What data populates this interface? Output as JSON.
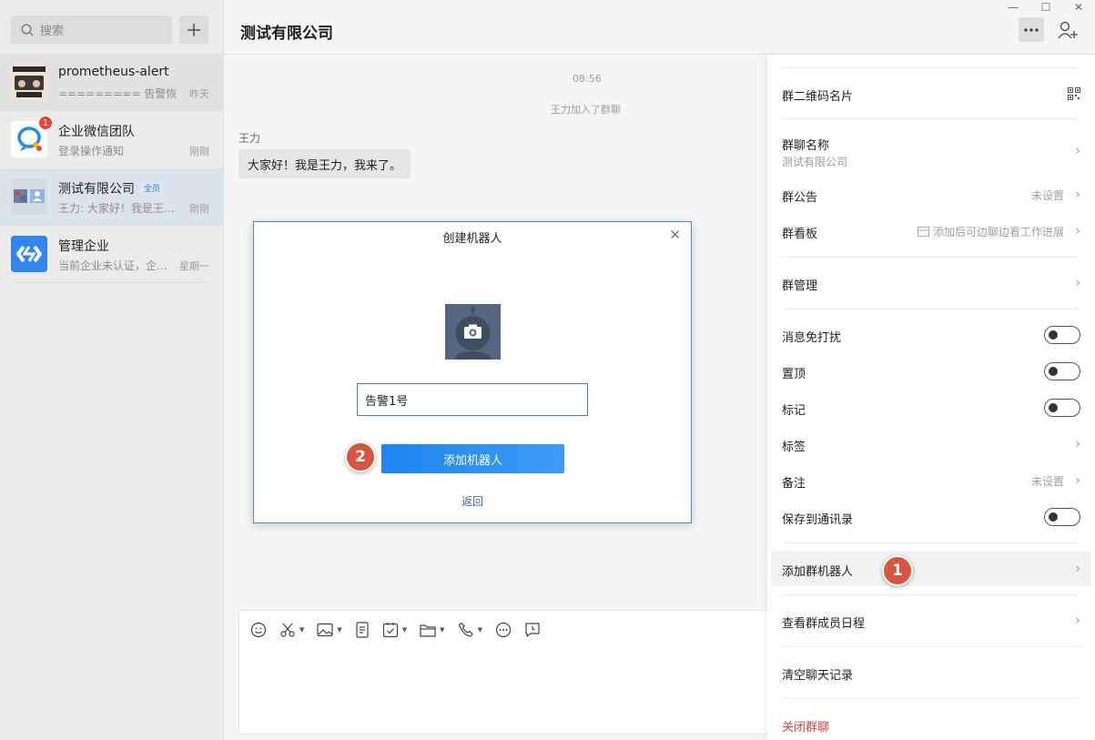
{
  "sidebar": {
    "search_placeholder": "搜索",
    "conversations": [
      {
        "name": "prometheus-alert",
        "preview": "========= 告警恢...",
        "time": "昨天",
        "badge": null
      },
      {
        "name": "企业微信团队",
        "preview": "登录操作通知",
        "time": "刚刚",
        "badge": "1"
      },
      {
        "name": "测试有限公司",
        "tag": "全员",
        "preview": "王力: 大家好！我是王...",
        "time": "刚刚"
      },
      {
        "name": "管理企业",
        "preview": "当前企业未认证，企...",
        "time": "星期一"
      }
    ]
  },
  "chat": {
    "title": "测试有限公司",
    "time_divider": "08:56",
    "system_message": "王力加入了群聊",
    "sender": "王力",
    "message": "大家好！我是王力，我来了。"
  },
  "dialog": {
    "title": "创建机器人",
    "name_value": "告警1号",
    "add_button": "添加机器人",
    "back_link": "返回"
  },
  "panel": {
    "qr_card": "群二维码名片",
    "group_name_label": "群聊名称",
    "group_name_value": "测试有限公司",
    "announcement": "群公告",
    "announcement_value": "未设置",
    "board": "群看板",
    "board_value": "添加后可边聊边看工作进展",
    "manage": "群管理",
    "mute": "消息免打扰",
    "pin": "置顶",
    "mark": "标记",
    "tags": "标签",
    "remark": "备注",
    "remark_value": "未设置",
    "save_contacts": "保存到通讯录",
    "add_robot": "添加群机器人",
    "schedule": "查看群成员日程",
    "clear_history": "清空聊天记录",
    "close_group": "关闭群聊"
  },
  "steps": {
    "one": "1",
    "two": "2"
  },
  "colors": {
    "accent": "#1f84f0",
    "danger": "#e0413a",
    "step_badge": "#d9553e"
  }
}
